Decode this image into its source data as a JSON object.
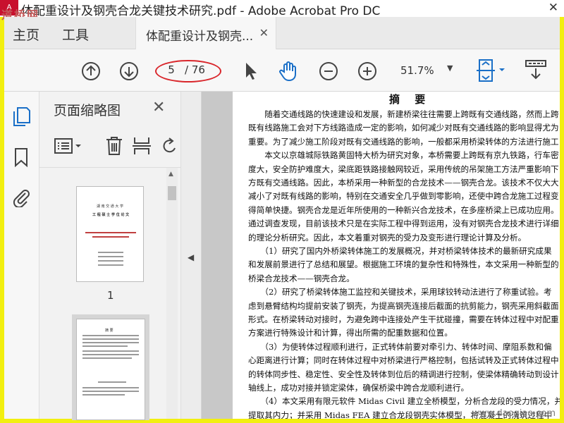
{
  "window": {
    "title": "体配重设计及钢壳合龙关键技术研究.pdf - Adobe Acrobat Pro DC",
    "watermark_top": "道桥网",
    "close_glyph": "✕"
  },
  "nav": {
    "home": "主页",
    "tools": "工具",
    "doc_tab_label": "体配重设计及钢壳...",
    "doc_tab_close": "✕"
  },
  "toolbar": {
    "page_current": "5",
    "page_total": "/ 76",
    "zoom": "51.7%",
    "icons": [
      "prev-page-icon",
      "next-page-icon",
      "select-arrow-icon",
      "hand-tool-icon",
      "zoom-out-icon",
      "zoom-in-icon",
      "page-fit-icon",
      "scroll-mode-icon"
    ]
  },
  "thumbnails": {
    "panel_title": "页面缩略图",
    "close_glyph": "✕",
    "pages": [
      {
        "number": "1",
        "lines": [
          "湖 南 交 通 大 学",
          "工 程 硕 士 学 位 论 文"
        ]
      },
      {
        "number": "",
        "lines": [
          "摘 要"
        ]
      }
    ]
  },
  "document": {
    "heading": "摘 要",
    "lines": [
      "　　随着交通线路的快速建设和发展，新建桥梁往往需要上跨既有交通线路，然而上跨",
      "既有线路施工会对下方线路造成一定的影响，如何减少对既有交通线路的影响显得尤为",
      "重要。为了减少施工阶段对既有交通线路的影响，一般都采用桥梁转体的方法进行施工",
      "　　本文以京雄城际铁路黄固特大桥为研究对象，本桥需要上跨既有京九铁路，行车密",
      "度大，安全防护难度大，梁底距铁路接触网较近，采用传统的吊架施工方法严重影响下",
      "方既有交通线路。因此，本桥采用一种新型的合龙技术——钢壳合龙。该技术不仅大大",
      "减小了对既有线路的影响，特别在交通安全几乎做到零影响，还使中跨合龙施工过程变",
      "得简单快捷。钢壳合龙是近年所使用的一种新兴合龙技术，在多座桥梁上已成功应用。",
      "通过调查发现，目前该技术只是在实际工程中得到运用，没有对钢壳合龙技术进行详细",
      "的理论分析研究。因此，本文着重对钢壳的受力及变形进行理论计算及分析。",
      "　　（1）研究了国内外桥梁转体施工的发展概况，并对桥梁转体技术的最新研究成果",
      "和发展前景进行了总结和展望。根据施工环境的复杂性和特殊性，本文采用一种新型的",
      "桥梁合龙技术——钢壳合龙。",
      "　　（2）研究了桥梁转体施工监控和关键技术，采用球铰转动法进行了称重试验。考",
      "虑到悬臂结构均提前安装了钢壳，为提高钢壳连接后截面的抗剪能力，钢壳采用斜截面",
      "形式。在桥梁转动对接时，为避免跨中连接处产生干扰碰撞，需要在转体过程中对配重",
      "方案进行特殊设计和计算，得出所需的配重数据和位置。",
      "　　（3）为使转体过程顺利进行，正式转体前要对牵引力、转体时间、摩阻系数和偏",
      "心距离进行计算；同时在转体过程中对桥梁进行严格控制，包括试转及正式转体过程中",
      "的转体同步性、稳定性、安全性及转体到位后的精调进行控制，使梁体精确转动到设计",
      "轴线上，成功对接并锁定梁体，确保桥梁中跨合龙顺利进行。",
      "　　（4）本文采用有限元软件 Midas Civil 建立全桥模型，分析合龙段的受力情况，并",
      "提取其内力；并采用 Midas FEA 建立合龙段钢壳实体模型，将混凝土的浇筑过程中"
    ],
    "watermark_bottom": "www.daoqiao.com"
  }
}
